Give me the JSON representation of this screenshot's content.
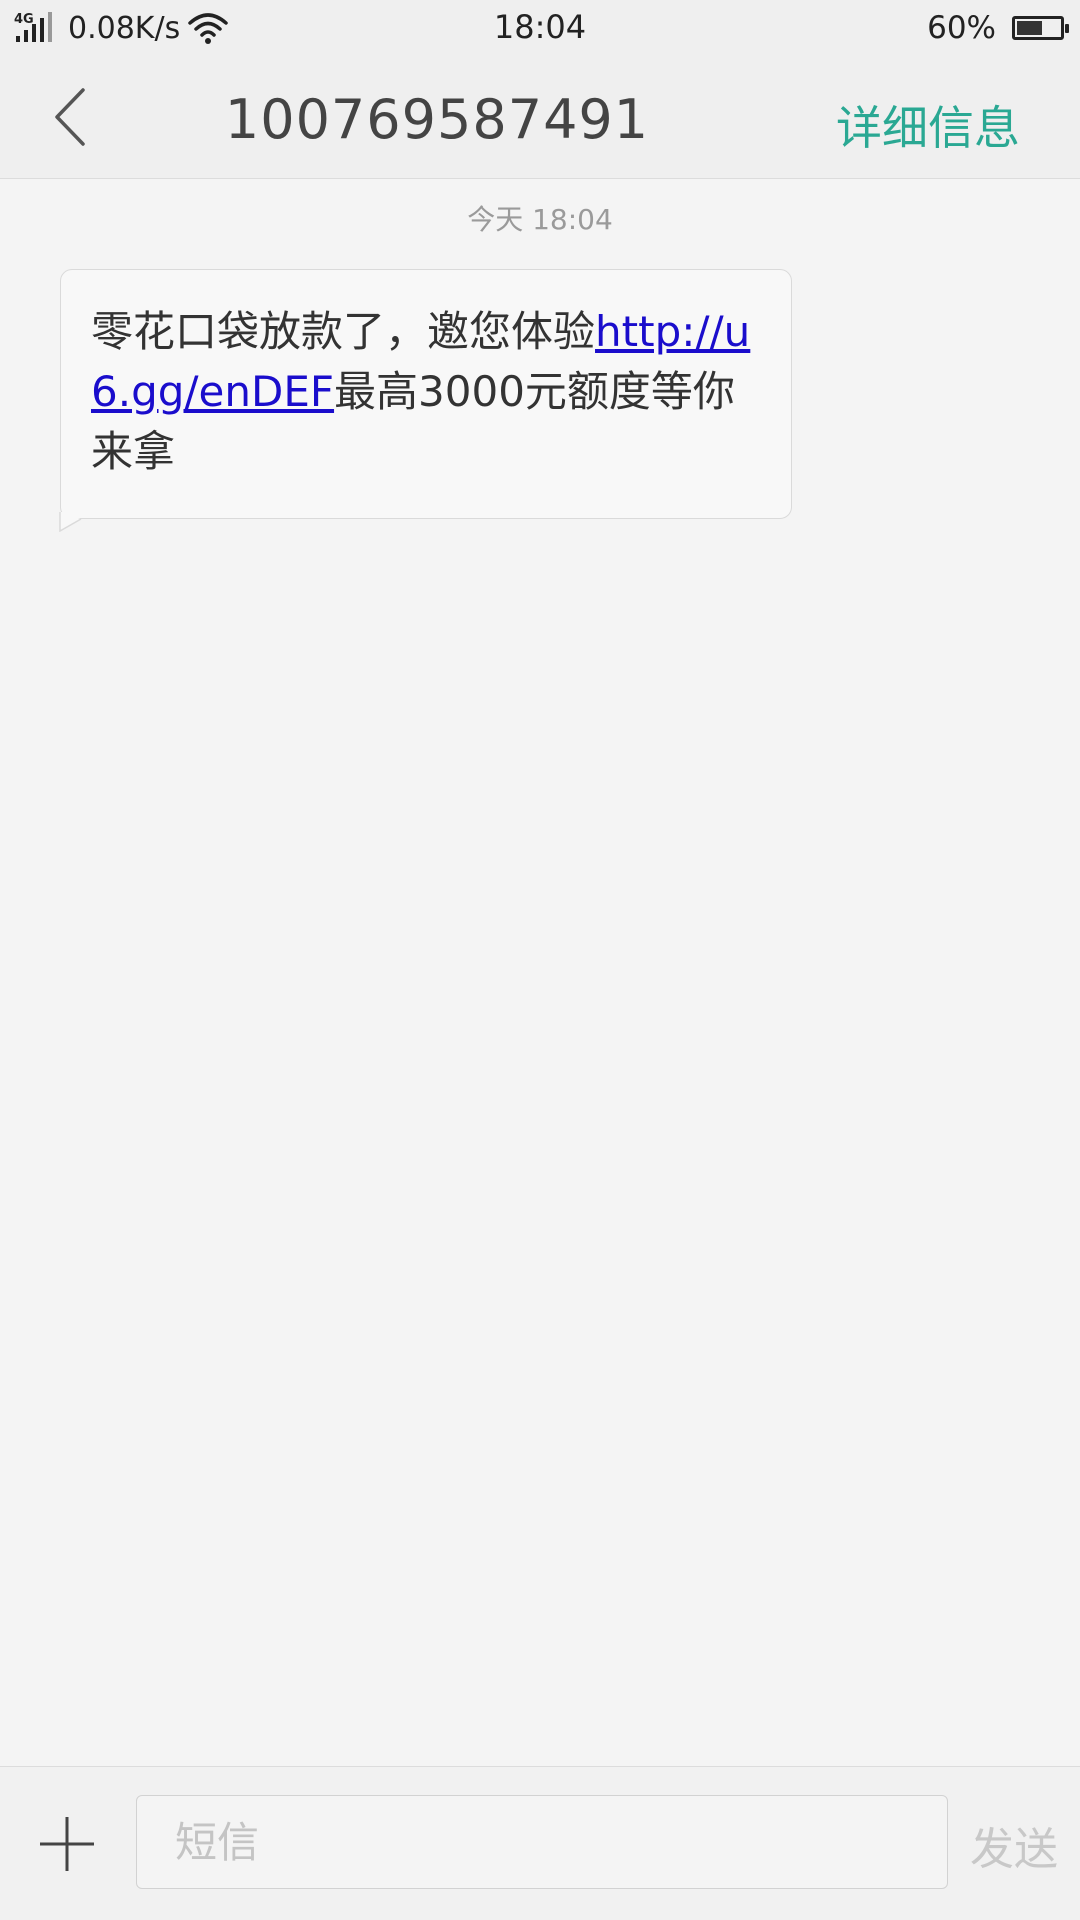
{
  "status_bar": {
    "network_type": "4G",
    "speed": "0.08K/s",
    "time": "18:04",
    "battery_percent": "60%",
    "battery_level": 0.6
  },
  "header": {
    "title": "100769587491",
    "details_label": "详细信息"
  },
  "conversation": {
    "date_label": "今天  18:04",
    "messages": [
      {
        "text_before": "零花口袋放款了，邀您体验",
        "link": "http://u6.gg/enDEF",
        "text_after": "最高3000元额度等你来拿"
      }
    ]
  },
  "input_bar": {
    "placeholder": "短信",
    "send_label": "发送"
  },
  "colors": {
    "accent": "#2aa893",
    "link": "#1a0dcc",
    "background": "#f4f4f4"
  },
  "icons": [
    "signal-icon",
    "wifi-icon",
    "battery-icon",
    "back-arrow-icon",
    "plus-icon"
  ]
}
